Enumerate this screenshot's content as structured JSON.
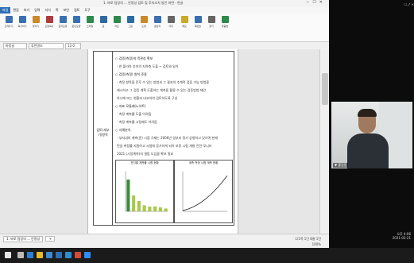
{
  "window": {
    "title": "1. 바로 팀장의 ... 안정성 검토 및 후속조치 방안 마련 - 한글"
  },
  "menu": [
    {
      "label": "파일"
    },
    {
      "label": "편집"
    },
    {
      "label": "보기"
    },
    {
      "label": "입력"
    },
    {
      "label": "서식"
    },
    {
      "label": "쪽"
    },
    {
      "label": "보안"
    },
    {
      "label": "검토"
    },
    {
      "label": "도구"
    }
  ],
  "ribbon": {
    "buttons": [
      {
        "label": "오려두기",
        "color": "#3a6fb0"
      },
      {
        "label": "복사하기",
        "color": "#3a6fb0"
      },
      {
        "label": "붙이기",
        "color": "#c98a2a"
      },
      {
        "label": "모양복사",
        "color": "#b03a3a"
      },
      {
        "label": "글자모양",
        "color": "#3a6fb0"
      },
      {
        "label": "문단모양",
        "color": "#3a6fb0"
      },
      {
        "label": "스타일",
        "color": "#2d8a4a"
      },
      {
        "label": "표",
        "color": "#2d6aa0"
      },
      {
        "label": "차트",
        "color": "#2d8a4a"
      },
      {
        "label": "그림",
        "color": "#2d6aa0"
      },
      {
        "label": "도형",
        "color": "#c98a2a"
      },
      {
        "label": "글상자",
        "color": "#3a6fb0"
      },
      {
        "label": "각주",
        "color": "#666666"
      },
      {
        "label": "메모",
        "color": "#c9a82a"
      },
      {
        "label": "쪽번호",
        "color": "#3a6fb0"
      },
      {
        "label": "찾기",
        "color": "#666666"
      },
      {
        "label": "맞춤법",
        "color": "#2d8a4a"
      }
    ]
  },
  "format": {
    "style": "바탕글",
    "font": "휴먼명조",
    "size": "12.0"
  },
  "document": {
    "row_label": "검토(세부기)항목",
    "lines": [
      {
        "text": "○ 검증(측정)의 객관성 확보",
        "type": "head"
      },
      {
        "text": "- 한 플라자 부지의 지하층 도출 → 검토와 일치",
        "type": "ind"
      },
      {
        "text": "○ 검증(측정) 원칙 준용",
        "type": "head"
      },
      {
        "text": "- 측정 항목을 전후 수 있는 방법과 그 결과의 추계적 검증 가능 방법을",
        "type": "ind"
      },
      {
        "text": "  제시하고 그 검증 계획 도출하는 계측을 활용 수 있는 검증방법 제안",
        "type": "ind"
      },
      {
        "text": "  하나에 또는 현황과 비교하여 검토하도록 구성",
        "type": "ind"
      },
      {
        "text": "○ 지표 모듈레(노아트)",
        "type": "head"
      },
      {
        "text": "- 측정 계측률 도출 어려움",
        "type": "ind"
      },
      {
        "text": "- 측정 계측률 고정제도 어려움",
        "type": "ind"
      },
      {
        "text": "○ 사례분석",
        "type": "head"
      },
      {
        "text": "- 부지내의 계측(준) 시점 규제는 2006년 일부터 정기 상향하고 있으며 현재",
        "type": "ind"
      },
      {
        "text": "  먼글 측정률 지질하고 시험에 증가하게 되어 보정 시험 개발 진전 모니터",
        "type": "ind"
      },
      {
        "text": "  2021 (시장계측)의 결합 도입을 확보 필요",
        "type": "ind"
      }
    ]
  },
  "figure_left": {
    "caption": "전지별 계측률 시험 현황"
  },
  "figure_right": {
    "caption": "계측 측정 시험 계측 현황"
  },
  "chart_data": [
    {
      "type": "bar",
      "title": "",
      "categories": [
        "A",
        "B",
        "C",
        "D",
        "E",
        "F",
        "G",
        "H"
      ],
      "values": [
        2000,
        1000,
        650,
        380,
        300,
        310,
        250,
        180
      ],
      "ylim": [
        0,
        2500
      ],
      "colors": [
        "#3a8a3a",
        "#a8c84a",
        "#a8c84a",
        "#a8c84a",
        "#a8c84a",
        "#a8c84a",
        "#a8c84a",
        "#a8c84a"
      ]
    },
    {
      "type": "line",
      "title": "",
      "x": [
        0,
        1,
        2,
        3,
        4,
        5,
        6,
        7,
        8
      ],
      "y": [
        0.2,
        0.6,
        1.2,
        2.0,
        3.0,
        4.2,
        5.6,
        7.2,
        9.0
      ],
      "ylim": [
        0,
        10
      ]
    }
  ],
  "status": {
    "tabs": [
      {
        "label": "1. 바로 팀장의 ... 안정성"
      },
      {
        "label": "+"
      }
    ],
    "info": "1/1쪽  1단  8줄  1칸",
    "zoom": "100%"
  },
  "webcam": {
    "controls": "☐  ⤢  ✕",
    "name": "▼ 홍길동",
    "time": "오후 4:06",
    "date": "2021-03-21"
  },
  "taskbar": {
    "icons": [
      {
        "name": "windows-icon",
        "color": "#e8e8e8"
      },
      {
        "name": "search-icon",
        "color": "#bbbbbb"
      },
      {
        "name": "edge-icon",
        "color": "#2b7fd4"
      },
      {
        "name": "folder-icon",
        "color": "#e8b92b"
      },
      {
        "name": "store-icon",
        "color": "#3a8ad4"
      },
      {
        "name": "mail-icon",
        "color": "#2f6fb5"
      },
      {
        "name": "hwp-icon",
        "color": "#2b8fd4"
      },
      {
        "name": "chrome-icon",
        "color": "#d44a3a"
      },
      {
        "name": "zoom-icon",
        "color": "#2d8cff"
      }
    ]
  }
}
